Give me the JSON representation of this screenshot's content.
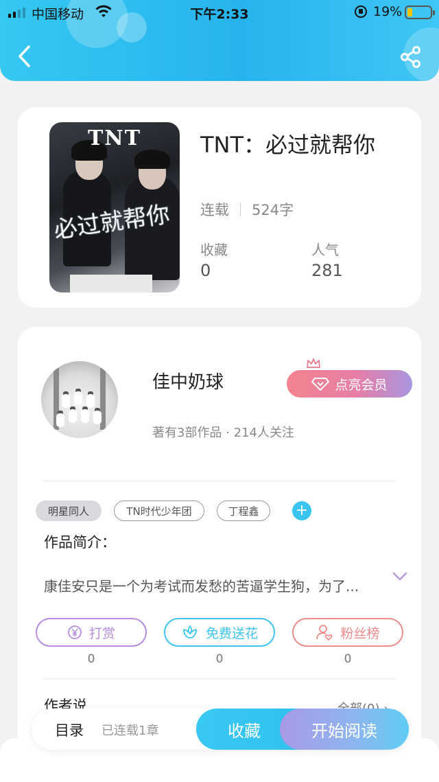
{
  "status_bar": {
    "carrier": "中国移动",
    "time": "下午2:33",
    "battery_percent": "19%",
    "battery_level": 0.19,
    "battery_color": "#f3c400"
  },
  "nav": {
    "back_icon": "chevron-left-icon",
    "share_icon": "share-icon",
    "accent_color": "#27b4ee"
  },
  "book": {
    "title": "TNT：必过就帮你",
    "status": "连载",
    "word_count": "524字",
    "cover_logo": "TNT",
    "cover_text": "必过就帮你",
    "stats": [
      {
        "label": "收藏",
        "value": "0"
      },
      {
        "label": "人气",
        "value": "281"
      }
    ]
  },
  "author": {
    "name": "佳中奶球",
    "summary": "著有3部作品 · 214人关注",
    "vip_label": "点亮会员"
  },
  "tags": [
    "明星同人",
    "TN时代少年团",
    "丁程鑫"
  ],
  "intro": {
    "title": "作品简介：",
    "text": "康佳安只是一个为考试而发愁的苦逼学生狗，为了..."
  },
  "actions": [
    {
      "label": "打赏",
      "count": "0",
      "icon": "yen-coin-icon",
      "color": "#b48ce0"
    },
    {
      "label": "免费送花",
      "count": "0",
      "icon": "flower-icon",
      "color": "#3cc4f0"
    },
    {
      "label": "粉丝榜",
      "count": "0",
      "icon": "fan-ranking-icon",
      "color": "#ef8a8a"
    }
  ],
  "author_says": {
    "title": "作者说",
    "view_all": "全部(0)"
  },
  "bottom_bar": {
    "toc_label": "目录",
    "chapters_label": "已连载1章",
    "favorite_label": "收藏",
    "read_label": "开始阅读"
  }
}
